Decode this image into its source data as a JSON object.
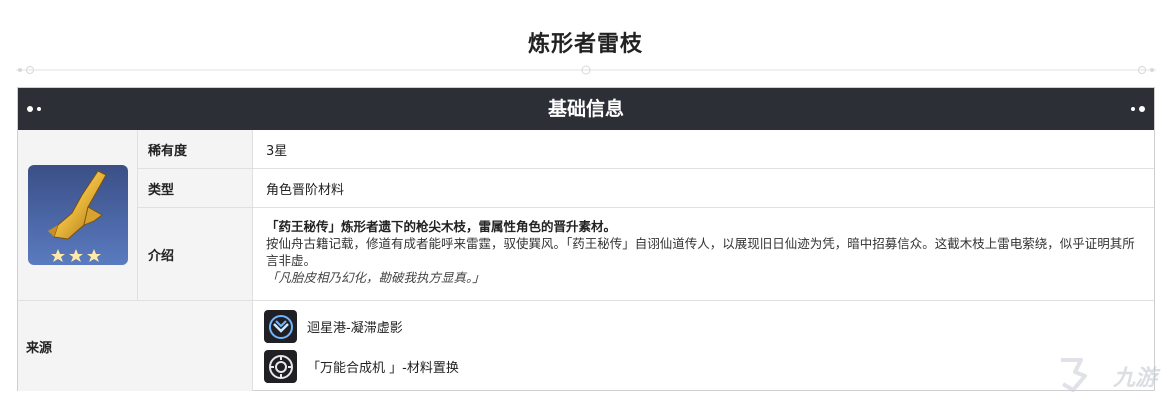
{
  "page": {
    "title": "炼形者雷枝"
  },
  "section": {
    "header": "基础信息"
  },
  "item": {
    "icon_name": "thunder-branch-item-icon",
    "rarity_label": "稀有度",
    "rarity_value": "3星",
    "type_label": "类型",
    "type_value": "角色晋阶材料",
    "desc_label": "介绍",
    "desc_headline": "「药王秘传」炼形者遗下的枪尖木枝，雷属性角色的晋升素材。",
    "desc_body": "按仙舟古籍记载，修道有成者能呼来雷霆，驭使巽风。「药王秘传」自诩仙道传人，以展现旧日仙迹为凭，暗中招募信众。这截木枝上雷电萦绕，似乎证明其所言非虚。",
    "desc_quote": "「凡胎皮相乃幻化，勘破我执方显真。」"
  },
  "source": {
    "label": "来源",
    "items": [
      {
        "text": "迴星港-凝滞虚影",
        "icon": "stagnant-shadow-icon"
      },
      {
        "text": "「万能合成机 」-材料置换",
        "icon": "synthesizer-icon"
      }
    ]
  },
  "watermark": {
    "text": "九游"
  },
  "colors": {
    "header_bg": "#2c2f36",
    "label_bg": "#f4f4f4",
    "icon_bg": "#1f1f24"
  }
}
